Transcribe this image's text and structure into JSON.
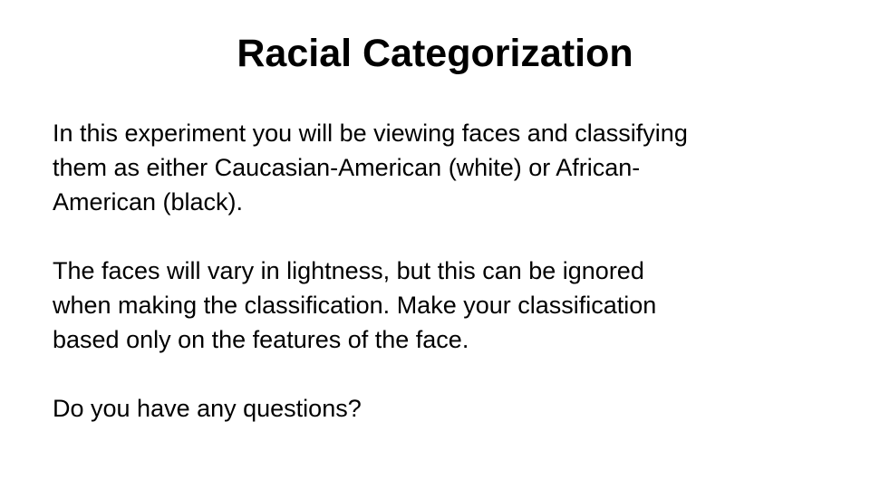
{
  "slide": {
    "title": "Racial Categorization",
    "paragraphs": [
      {
        "lines": [
          "In this experiment you will be viewing faces and classifying",
          "them as either Caucasian-American (white) or African-",
          "American (black)."
        ]
      },
      {
        "lines": [
          "The faces will vary in lightness, but this can be ignored",
          "when making the classification. Make your classification",
          "based only on the features of the face."
        ]
      },
      {
        "lines": [
          "Do you have any questions?"
        ]
      }
    ]
  }
}
